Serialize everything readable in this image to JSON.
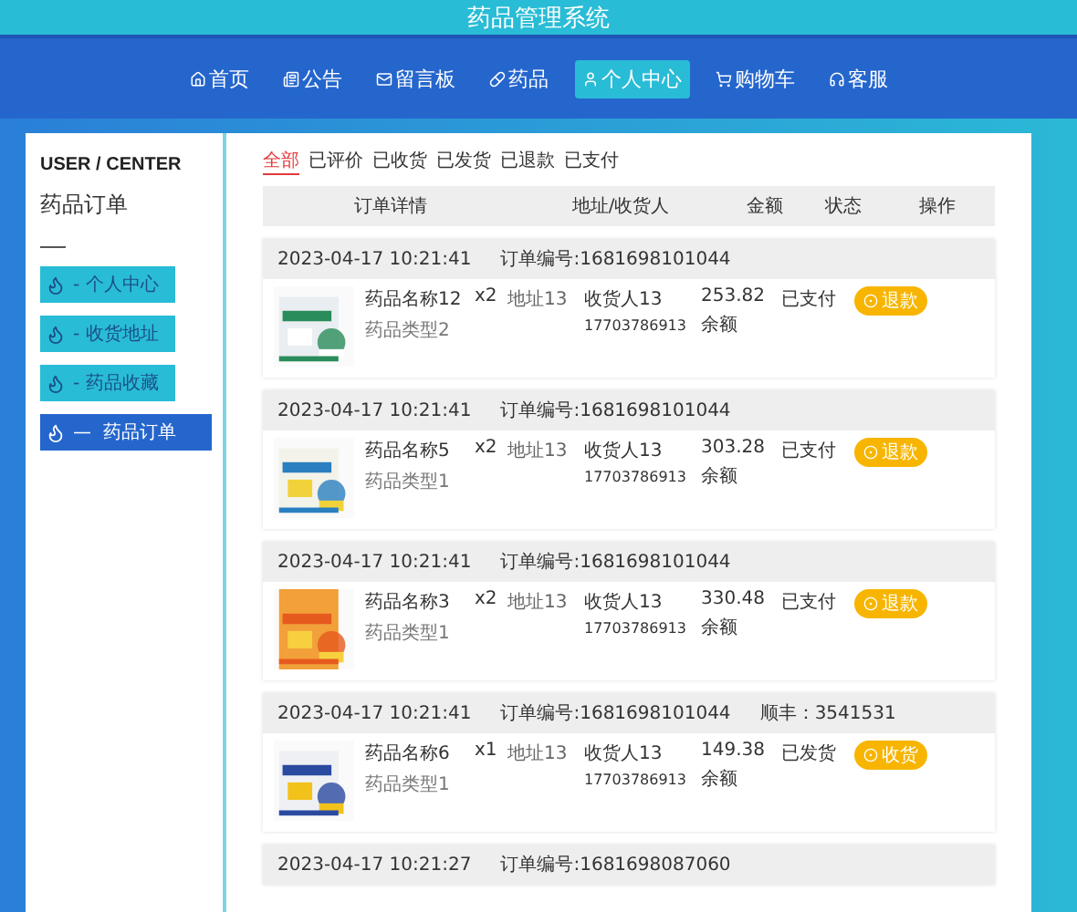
{
  "header": {
    "title": "药品管理系统"
  },
  "nav": [
    {
      "label": "首页",
      "selected": false
    },
    {
      "label": "公告",
      "selected": false
    },
    {
      "label": "留言板",
      "selected": false
    },
    {
      "label": "药品",
      "selected": false
    },
    {
      "label": "个人中心",
      "selected": true
    },
    {
      "label": "购物车",
      "selected": false
    },
    {
      "label": "客服",
      "selected": false
    }
  ],
  "sidebar": {
    "heading": "USER / CENTER",
    "subtitle": "药品订单",
    "items": [
      {
        "label": "- 个人中心",
        "selected": false
      },
      {
        "label": "- 收货地址",
        "selected": false
      },
      {
        "label": "- 药品收藏",
        "selected": false
      },
      {
        "label": "—  药品订单",
        "selected": true
      }
    ]
  },
  "tabs": [
    {
      "label": "全部",
      "selected": true
    },
    {
      "label": "已评价",
      "selected": false
    },
    {
      "label": "已收货",
      "selected": false
    },
    {
      "label": "已发货",
      "selected": false
    },
    {
      "label": "已退款",
      "selected": false
    },
    {
      "label": "已支付",
      "selected": false
    }
  ],
  "table": {
    "columns": [
      "订单详情",
      "地址/收货人",
      "金额",
      "状态",
      "操作"
    ],
    "orders": [
      {
        "time": "2023-04-17 10:21:41",
        "order_no": "订单编号:1681698101044",
        "items": [
          {
            "kind": "picture",
            "name": "药品名称12",
            "type": "药品类型2",
            "qty": "x2",
            "address": "地址13",
            "receiver": "收货人13",
            "phone": "17703786913",
            "amount": "253.82",
            "pay": "余额",
            "status": "已支付",
            "action": "退款"
          }
        ]
      },
      {
        "time": "2023-04-17 10:21:41",
        "order_no": "订单编号:1681698101044",
        "items": [
          {
            "kind": "picture",
            "name": "药品名称5",
            "type": "药品类型1",
            "qty": "x2",
            "address": "地址13",
            "receiver": "收货人13",
            "phone": "17703786913",
            "amount": "303.28",
            "pay": "余额",
            "status": "已支付",
            "action": "退款"
          }
        ]
      },
      {
        "time": "2023-04-17 10:21:41",
        "order_no": "订单编号:1681698101044",
        "items": [
          {
            "kind": "picture",
            "name": "药品名称3",
            "type": "药品类型1",
            "qty": "x2",
            "address": "地址13",
            "receiver": "收货人13",
            "phone": "17703786913",
            "amount": "330.48",
            "pay": "余额",
            "status": "已支付",
            "action": "退款"
          }
        ]
      },
      {
        "time": "2023-04-17 10:21:41",
        "order_no": "订单编号:1681698101044",
        "tracking": "顺丰：3541531",
        "items": [
          {
            "kind": "picture",
            "name": "药品名称6",
            "type": "药品类型1",
            "qty": "x1",
            "address": "地址13",
            "receiver": "收货人13",
            "phone": "17703786913",
            "amount": "149.38",
            "pay": "余额",
            "status": "已发货",
            "action": "收货"
          }
        ]
      },
      {
        "time": "2023-04-17 10:21:27",
        "order_no": "订单编号:1681698087060"
      }
    ]
  }
}
